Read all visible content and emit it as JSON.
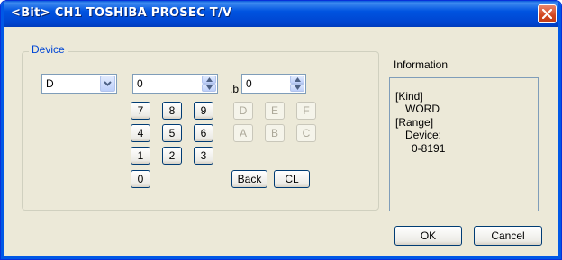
{
  "window": {
    "title": "<Bit> CH1 TOSHIBA PROSEC T/V"
  },
  "device": {
    "legend": "Device",
    "type_value": "D",
    "address_value": "0",
    "bit_separator": ".b",
    "bit_value": "0"
  },
  "keypad": {
    "digits": [
      "7",
      "8",
      "9",
      "4",
      "5",
      "6",
      "1",
      "2",
      "3",
      "0"
    ],
    "hex": [
      "D",
      "E",
      "F",
      "A",
      "B",
      "C"
    ],
    "back_label": "Back",
    "clear_label": "CL"
  },
  "information": {
    "label": "Information",
    "kind_heading": "[Kind]",
    "kind_value": "WORD",
    "range_heading": "[Range]",
    "range_device_label": "Device:",
    "range_value": "0-8191"
  },
  "buttons": {
    "ok": "OK",
    "cancel": "Cancel"
  },
  "icons": {
    "close": "close-icon",
    "dropdown": "chevron-down-icon",
    "spin_up": "spin-up-icon",
    "spin_down": "spin-down-icon"
  }
}
